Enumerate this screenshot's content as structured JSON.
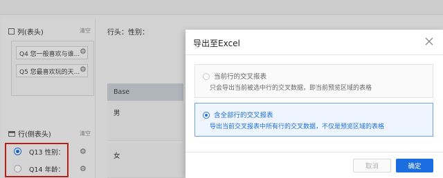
{
  "background": {
    "columns_section": {
      "title": "列(表头)",
      "clear": "清空"
    },
    "column_items": [
      "Q4 您一般喜欢与谁...",
      "Q5 您最喜欢玩的天..."
    ],
    "rows_section": {
      "title": "行(侧表头)",
      "clear": "清空"
    },
    "row_items": [
      {
        "label": "Q13 性别：",
        "selected": true
      },
      {
        "label": "Q14 年龄：",
        "selected": false
      }
    ],
    "row_header_label": "行头：性别：",
    "grid": {
      "header": "Base",
      "rows": [
        "男",
        "女"
      ]
    }
  },
  "dialog": {
    "title": "导出至Excel",
    "options": [
      {
        "title": "当前行的交叉报表",
        "desc": "只会导出当前被选中行的交叉数据，即当前预览区域的表格",
        "selected": false
      },
      {
        "title": "含全部行的交叉报表",
        "desc": "导出当前交叉报表中所有行的交叉数据，不仅是预览区域的表格",
        "selected": true
      }
    ],
    "cancel_label": "取消",
    "ok_label": "确定"
  },
  "colors": {
    "accent": "#1c6ee0",
    "highlight_border": "#d9221a"
  }
}
